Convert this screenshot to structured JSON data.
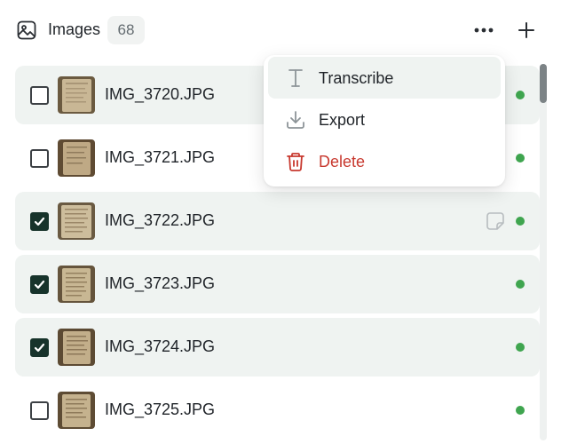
{
  "header": {
    "title": "Images",
    "count": "68",
    "icons": {
      "title": "image-icon",
      "more": "more-horizontal-icon",
      "add": "plus-icon"
    }
  },
  "menu": {
    "items": [
      {
        "label": "Transcribe",
        "icon": "text-cursor-icon"
      },
      {
        "label": "Export",
        "icon": "download-icon"
      },
      {
        "label": "Delete",
        "icon": "trash-icon",
        "color": "#c8392f"
      }
    ]
  },
  "files": [
    {
      "name": "IMG_3720.JPG",
      "checked": false,
      "status": "green"
    },
    {
      "name": "IMG_3721.JPG",
      "checked": false,
      "status": "green"
    },
    {
      "name": "IMG_3722.JPG",
      "checked": true,
      "status": "green",
      "note_icon": "note-icon"
    },
    {
      "name": "IMG_3723.JPG",
      "checked": true,
      "status": "green"
    },
    {
      "name": "IMG_3724.JPG",
      "checked": true,
      "status": "green"
    },
    {
      "name": "IMG_3725.JPG",
      "checked": false,
      "status": "green"
    }
  ],
  "colors": {
    "accent": "#17332b",
    "status_green": "#3fa54f",
    "row_tint": "#eff3f1",
    "danger": "#c8392f"
  }
}
